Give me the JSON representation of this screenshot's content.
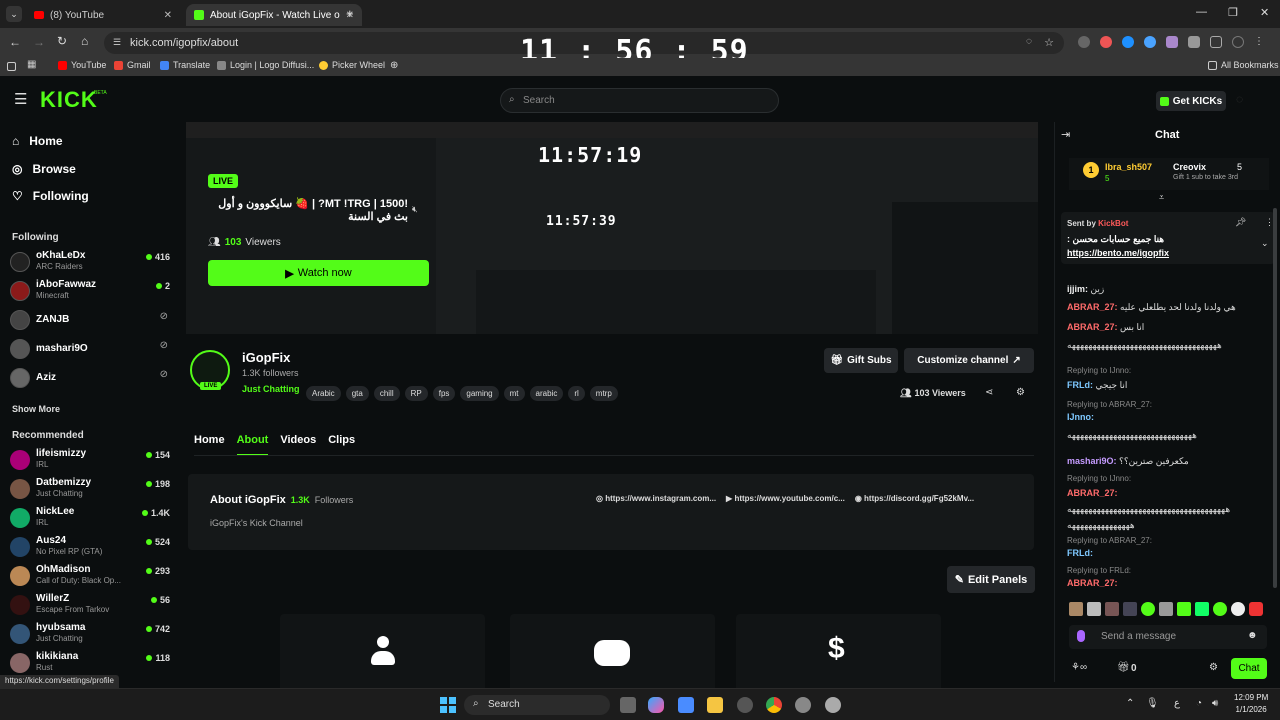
{
  "browser": {
    "tabs": [
      {
        "title": "(8) YouTube",
        "active": false
      },
      {
        "title": "About iGopFix - Watch Live on",
        "active": true
      }
    ],
    "url": "kick.com/igopfix/about",
    "clock": "11 : 56 : 59",
    "bookmarks": [
      "YouTube",
      "Gmail",
      "Translate",
      "Login | Logo Diffusi...",
      "Picker Wheel"
    ],
    "all_bookmarks": "All Bookmarks"
  },
  "header": {
    "logo": "KICK",
    "beta": "BETA",
    "search_placeholder": "Search",
    "get_kicks": "Get KICKs"
  },
  "sidebar": {
    "nav": [
      {
        "label": "Home",
        "icon": "home-icon"
      },
      {
        "label": "Browse",
        "icon": "compass-icon"
      },
      {
        "label": "Following",
        "icon": "heart-icon"
      }
    ],
    "following_title": "Following",
    "following": [
      {
        "name": "oKhaLeDx",
        "category": "ARC Raiders",
        "viewers": "416",
        "live": true,
        "color": "#222"
      },
      {
        "name": "iAboFawwaz",
        "category": "Minecraft",
        "viewers": "2",
        "live": true,
        "color": "#8b1a1a"
      },
      {
        "name": "ZANJB",
        "category": "",
        "viewers": "",
        "live": false,
        "color": "#444"
      },
      {
        "name": "mashari9O",
        "category": "",
        "viewers": "",
        "live": false,
        "color": "#555"
      },
      {
        "name": "Aziz",
        "category": "",
        "viewers": "",
        "live": false,
        "color": "#666"
      }
    ],
    "show_more": "Show More",
    "recommended_title": "Recommended",
    "recommended": [
      {
        "name": "lifeismizzy",
        "category": "IRL",
        "viewers": "154",
        "color": "#a07"
      },
      {
        "name": "Datbemizzy",
        "category": "Just Chatting",
        "viewers": "198",
        "color": "#754"
      },
      {
        "name": "NickLee",
        "category": "IRL",
        "viewers": "1.4K",
        "color": "#1a6"
      },
      {
        "name": "Aus24",
        "category": "No Pixel RP (GTA)",
        "viewers": "524",
        "color": "#246"
      },
      {
        "name": "OhMadison",
        "category": "Call of Duty: Black Op...",
        "viewers": "293",
        "color": "#b85"
      },
      {
        "name": "WillerZ",
        "category": "Escape From Tarkov",
        "viewers": "56",
        "color": "#311"
      },
      {
        "name": "hyubsama",
        "category": "Just Chatting",
        "viewers": "742",
        "color": "#357"
      },
      {
        "name": "kikikiana",
        "category": "Rust",
        "viewers": "118",
        "color": "#866"
      }
    ]
  },
  "player": {
    "live_badge": "LIVE",
    "stream_title": "!MT !TRG | 1500? | 🍓 سايكووون و أول بث في السنة",
    "viewers_count": "103",
    "viewers_label": "Viewers",
    "watch_now": "Watch now",
    "nested_clock_1": "11:57:19",
    "nested_clock_2": "11:57:39"
  },
  "channel": {
    "name": "iGopFix",
    "followers": "1.3K followers",
    "category": "Just Chatting",
    "tags": [
      "Arabic",
      "gta",
      "chill",
      "RP",
      "fps",
      "gaming",
      "mt",
      "arabic",
      "rl",
      "mtrp"
    ],
    "gift_subs": "Gift Subs",
    "customize": "Customize channel",
    "viewers": "103 Viewers",
    "avatar_badge": "LIVE"
  },
  "tabs": [
    {
      "label": "Home",
      "active": false
    },
    {
      "label": "About",
      "active": true
    },
    {
      "label": "Videos",
      "active": false
    },
    {
      "label": "Clips",
      "active": false
    }
  ],
  "about": {
    "title": "About iGopFix",
    "followers_count": "1.3K",
    "followers_label": "Followers",
    "description": "iGopFix's Kick Channel",
    "links": [
      {
        "icon": "instagram-icon",
        "text": "https://www.instagram.com..."
      },
      {
        "icon": "youtube-icon",
        "text": "https://www.youtube.com/c..."
      },
      {
        "icon": "discord-icon",
        "text": "https://discord.gg/Fg52kMv..."
      }
    ]
  },
  "edit_panels": "Edit Panels",
  "chat": {
    "title": "Chat",
    "sub_banner": {
      "user": "Ibra_sh507",
      "other": "Creovix",
      "count": "5",
      "other_count": "5",
      "text": "Gift 1 sub to take 3rd"
    },
    "pinned": {
      "sent_by": "Sent by",
      "bot": "KickBot",
      "text": "هنا جميع حسابات محسن :",
      "link": "https://bento.me/igopfix"
    },
    "messages": [
      {
        "user": "ijjim:",
        "text": "زين",
        "color": "#f0f0f0"
      },
      {
        "user": "ABRAR_27:",
        "text": "هي ولدنا ولدنا لحد يطلعلي عليه",
        "color": "#ff6b6b"
      },
      {
        "user": "ABRAR_27:",
        "text": "انا بس",
        "color": "#ff6b6b"
      },
      {
        "user": "",
        "text": "ههههههههههههههههههههههههههههههههههههه",
        "color": "#ddd"
      },
      {
        "user": "FRLd:",
        "text": "انا جيجي",
        "color": "#7ec8ff"
      },
      {
        "user": "IJnno:",
        "text": "",
        "color": "#7ec8ff"
      },
      {
        "user": "",
        "text": "ههههههههههههههههههههههههههههههه",
        "color": "#ddd"
      },
      {
        "user": "mashari9O:",
        "text": "مكعرفين صترين؟؟",
        "color": "#c59bff"
      },
      {
        "user": "ABRAR_27:",
        "text": "",
        "color": "#ff6b6b"
      },
      {
        "user": "",
        "text": "ههههههههههههههههههههههههههههههههههههههه",
        "color": "#ddd"
      },
      {
        "user": "",
        "text": "هههههههههههههههه",
        "color": "#ddd"
      },
      {
        "user": "FRLd:",
        "text": "",
        "color": "#7ec8ff"
      },
      {
        "user": "ABRAR_27:",
        "text": "",
        "color": "#ff6b6b"
      }
    ],
    "replies": [
      "Replying to IJnno:",
      "Replying to ABRAR_27:",
      "Replying to IJnno:",
      "Replying to ABRAR_27:",
      "Replying to FRLd:"
    ],
    "send_placeholder": "Send a message",
    "chat_button": "Chat",
    "count": "0"
  },
  "status_url": "https://kick.com/settings/profile",
  "taskbar": {
    "search": "Search",
    "time": "12:09 PM",
    "date": "1/1/2026"
  }
}
